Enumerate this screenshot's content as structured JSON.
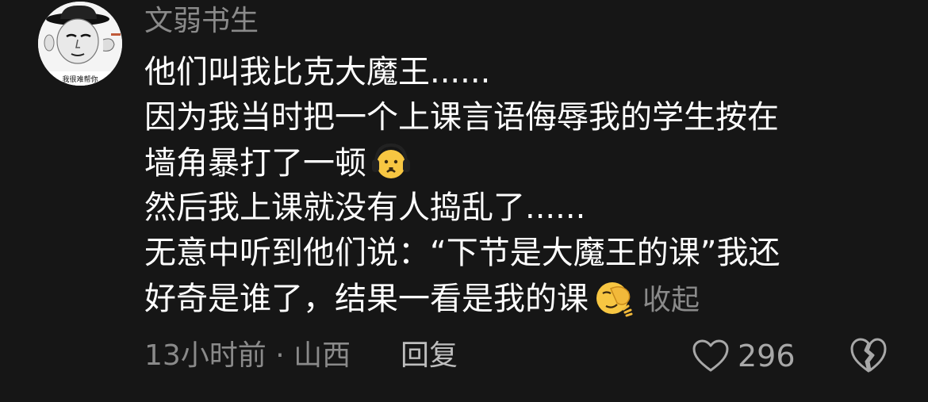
{
  "comment": {
    "author": {
      "name": "文弱书生",
      "avatar_caption": "我很难帮你"
    },
    "lines": [
      "他们叫我比克大魔王......",
      "因为我当时把一个上课言语侮辱我的学生按在",
      "墙角暴打了一顿",
      "然后我上课就没有人捣乱了......",
      "无意中听到他们说：“下节是大魔王的课”我还",
      "好奇是谁了，结果一看是我的课"
    ],
    "emojis": {
      "after_line_3": "headphones-sad-face-emoji",
      "after_line_6": "facepalm-emoji"
    },
    "collapse_label": "收起",
    "timestamp": "13小时前",
    "separator": " · ",
    "location": "山西",
    "reply_label": "回复",
    "like_count": "296"
  },
  "colors": {
    "background": "#161616",
    "primary_text": "#ffffff",
    "secondary_text": "#8a8a8a",
    "emoji_yellow": "#f7c642"
  },
  "icons": {
    "like": "heart-outline-icon",
    "dislike": "broken-heart-icon"
  }
}
